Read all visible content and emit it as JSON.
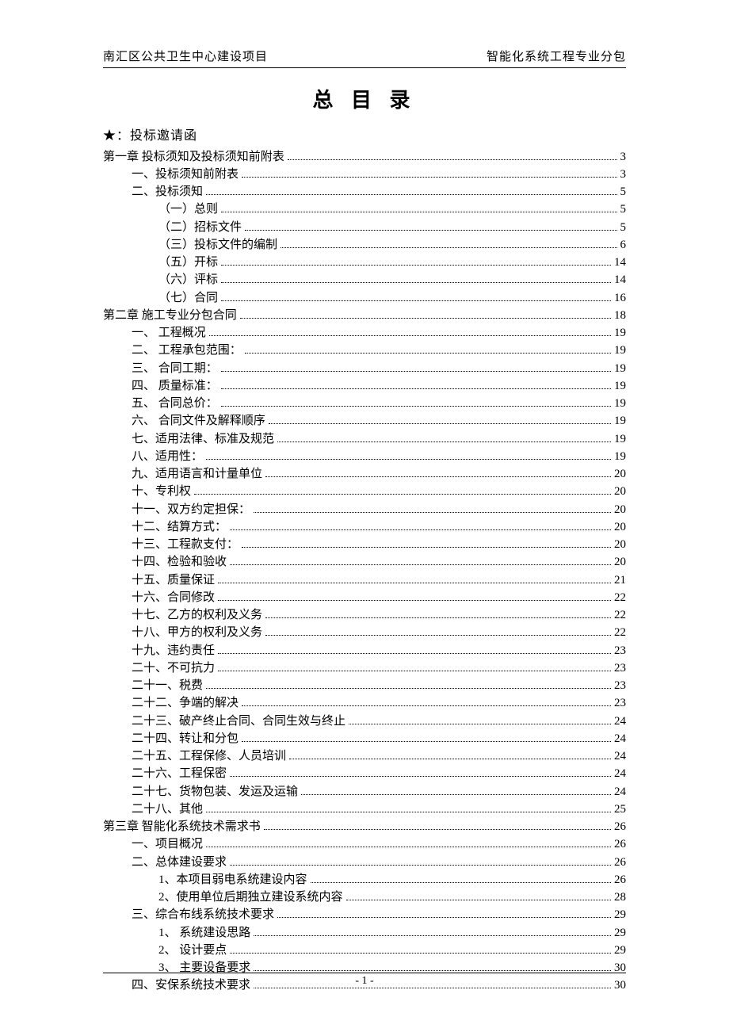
{
  "header": {
    "left": "南汇区公共卫生中心建设项目",
    "right": "智能化系统工程专业分包"
  },
  "title": "总 目 录",
  "star_line": "★：投标邀请函",
  "footer": {
    "page_number": "- 1 -"
  },
  "toc": [
    {
      "indent": 0,
      "label": "第一章 投标须知及投标须知前附表",
      "page": "3"
    },
    {
      "indent": 1,
      "label": "一、投标须知前附表",
      "page": "3"
    },
    {
      "indent": 1,
      "label": "二、投标须知",
      "page": "5"
    },
    {
      "indent": 2,
      "label": "（一）总则",
      "page": "5"
    },
    {
      "indent": 2,
      "label": "（二）招标文件",
      "page": "5"
    },
    {
      "indent": 2,
      "label": "（三）投标文件的编制",
      "page": "6"
    },
    {
      "indent": 2,
      "label": "（五）开标",
      "page": "14"
    },
    {
      "indent": 2,
      "label": "（六）评标",
      "page": "14"
    },
    {
      "indent": 2,
      "label": "（七）合同",
      "page": "16"
    },
    {
      "indent": 0,
      "label": "第二章   施工专业分包合同",
      "page": "18"
    },
    {
      "indent": 1,
      "label": "一、      工程概况",
      "page": "19"
    },
    {
      "indent": 1,
      "label": "二、      工程承包范围：",
      "page": "19"
    },
    {
      "indent": 1,
      "label": "三、      合同工期：",
      "page": "19"
    },
    {
      "indent": 1,
      "label": "四、      质量标准：",
      "page": "19"
    },
    {
      "indent": 1,
      "label": "五、      合同总价：",
      "page": "19"
    },
    {
      "indent": 1,
      "label": "六、   合同文件及解释顺序",
      "page": "19"
    },
    {
      "indent": 1,
      "label": "七、适用法律、标准及规范",
      "page": "19"
    },
    {
      "indent": 1,
      "label": "八、适用性：",
      "page": "19"
    },
    {
      "indent": 1,
      "label": "九、适用语言和计量单位",
      "page": "20"
    },
    {
      "indent": 1,
      "label": "十、专利权",
      "page": "20"
    },
    {
      "indent": 1,
      "label": "十一、双方约定担保：",
      "page": "20"
    },
    {
      "indent": 1,
      "label": "十二、结算方式：",
      "page": "20"
    },
    {
      "indent": 1,
      "label": "十三、工程款支付：",
      "page": "20"
    },
    {
      "indent": 1,
      "label": "十四、检验和验收",
      "page": "20"
    },
    {
      "indent": 1,
      "label": "十五、质量保证",
      "page": "21"
    },
    {
      "indent": 1,
      "label": "十六、合同修改",
      "page": "22"
    },
    {
      "indent": 1,
      "label": "十七、乙方的权利及义务",
      "page": "22"
    },
    {
      "indent": 1,
      "label": "十八、甲方的权利及义务",
      "page": "22"
    },
    {
      "indent": 1,
      "label": "十九、违约责任",
      "page": "23"
    },
    {
      "indent": 1,
      "label": "二十、不可抗力",
      "page": "23"
    },
    {
      "indent": 1,
      "label": "二十一、税费",
      "page": "23"
    },
    {
      "indent": 1,
      "label": "二十二、争端的解决",
      "page": "23"
    },
    {
      "indent": 1,
      "label": "二十三、破产终止合同、合同生效与终止",
      "page": "24"
    },
    {
      "indent": 1,
      "label": "二十四、转让和分包",
      "page": "24"
    },
    {
      "indent": 1,
      "label": "二十五、工程保修、人员培训",
      "page": "24"
    },
    {
      "indent": 1,
      "label": "二十六、工程保密",
      "page": "24"
    },
    {
      "indent": 1,
      "label": "二十七、货物包装、发运及运输",
      "page": "24"
    },
    {
      "indent": 1,
      "label": "二十八、其他",
      "page": "25"
    },
    {
      "indent": 0,
      "label": "第三章 智能化系统技术需求书",
      "page": "26"
    },
    {
      "indent": 1,
      "label": "一、项目概况",
      "page": "26"
    },
    {
      "indent": 1,
      "label": "二、总体建设要求",
      "page": "26"
    },
    {
      "indent": 2,
      "label": "1、本项目弱电系统建设内容",
      "page": "26"
    },
    {
      "indent": 2,
      "label": "2、使用单位后期独立建设系统内容",
      "page": "28"
    },
    {
      "indent": 1,
      "label": "三、综合布线系统技术要求",
      "page": "29"
    },
    {
      "indent": 2,
      "label": "1、   系统建设思路",
      "page": "29"
    },
    {
      "indent": 2,
      "label": "2、   设计要点",
      "page": "29"
    },
    {
      "indent": 2,
      "label": "3、   主要设备要求",
      "page": "30"
    },
    {
      "indent": 1,
      "label": "四、安保系统技术要求",
      "page": "30"
    }
  ]
}
